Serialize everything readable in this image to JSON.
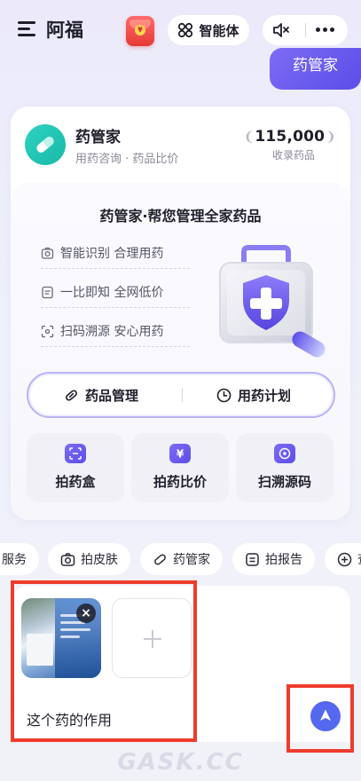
{
  "header": {
    "title": "阿福",
    "agent_label": "智能体",
    "red_packet_symbol": "¥"
  },
  "float_tag": "药管家",
  "card": {
    "name": "药管家",
    "subtitle": "用药咨询 · 药品比价",
    "stat_value": "115,000",
    "stat_label": "收录药品",
    "headline": "药管家·帮您管理全家药品",
    "features": [
      "智能识别 合理用药",
      "一比即知 全网低价",
      "扫码溯源 安心用药"
    ],
    "actions": [
      "药品管理",
      "用药计划"
    ],
    "tools": [
      "拍药盒",
      "拍药比价",
      "扫溯源码"
    ],
    "tool_glyph": "¥"
  },
  "chips": [
    "服务",
    "拍皮肤",
    "药管家",
    "拍报告",
    "查"
  ],
  "composer": {
    "close_symbol": "×",
    "input_text": "这个药的作用"
  },
  "watermark": "GASK.CC",
  "colors": {
    "accent": "#5b4de8",
    "teal": "#19b8a8",
    "highlight": "#ee3c2c",
    "send": "#5468f0"
  },
  "icons": {
    "menu": "menu-icon",
    "mute": "speaker-mute-icon",
    "more": "more-dots-icon",
    "send": "send-arrow-icon"
  }
}
